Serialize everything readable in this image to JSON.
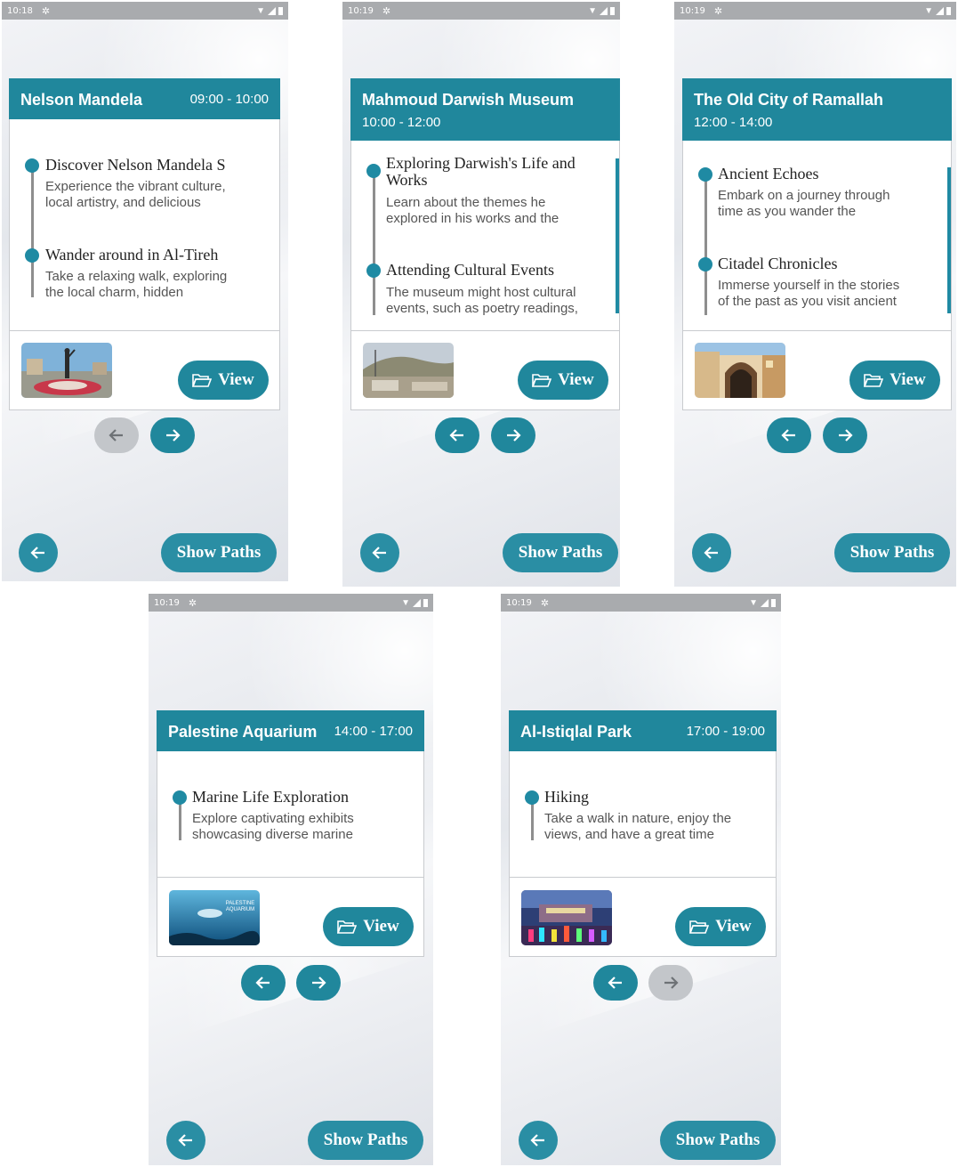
{
  "colors": {
    "accent": "#20879c",
    "disabled": "#c3c6ca",
    "status_bar": "#a9abae"
  },
  "view_label": "View",
  "show_paths_label": "Show Paths",
  "screens": [
    {
      "status_time": "10:18",
      "title": "Nelson Mandela",
      "time": "09:00 - 10:00",
      "prev_enabled": false,
      "next_enabled": true,
      "activities": [
        {
          "title": "Discover Nelson Mandela S",
          "desc1": "Experience the vibrant culture,",
          "desc2": "local artistry, and delicious"
        },
        {
          "title": "Wander around in Al-Tireh",
          "desc1": "Take a relaxing walk, exploring",
          "desc2": "the local charm, hidden"
        }
      ],
      "image_icon": "statue-plaza-photo"
    },
    {
      "status_time": "10:19",
      "title": "Mahmoud Darwish Museum",
      "time": "10:00 - 12:00",
      "prev_enabled": true,
      "next_enabled": true,
      "activities": [
        {
          "title": "Exploring Darwish's Life and",
          "title2": "Works",
          "desc1": "Learn about the themes he",
          "desc2": "explored in his works and the"
        },
        {
          "title": "Attending Cultural Events",
          "desc1": "The museum might host cultural",
          "desc2": "events, such as poetry readings,"
        }
      ],
      "image_icon": "museum-hill-photo"
    },
    {
      "status_time": "10:19",
      "title": "The Old City of Ramallah",
      "time": "12:00 - 14:00",
      "prev_enabled": true,
      "next_enabled": true,
      "activities": [
        {
          "title": "Ancient Echoes",
          "desc1": "Embark on a journey through",
          "desc2": "time as you wander the"
        },
        {
          "title": "Citadel Chronicles",
          "desc1": "Immerse yourself in the stories",
          "desc2": "of the past as you visit ancient"
        }
      ],
      "image_icon": "old-city-arch-photo"
    },
    {
      "status_time": "10:19",
      "title": "Palestine Aquarium",
      "time": "14:00 - 17:00",
      "prev_enabled": true,
      "next_enabled": true,
      "activities": [
        {
          "title": "Marine Life Exploration",
          "desc1": "Explore captivating exhibits",
          "desc2": "showcasing diverse marine"
        }
      ],
      "image_icon": "aquarium-photo",
      "image_text": "PALESTINE AQUARIUM"
    },
    {
      "status_time": "10:19",
      "title": "Al-Istiqlal Park",
      "time": "17:00 - 19:00",
      "prev_enabled": true,
      "next_enabled": false,
      "activities": [
        {
          "title": "Hiking",
          "desc1": "Take a walk in nature, enjoy the",
          "desc2": "views, and have a great time"
        }
      ],
      "image_icon": "park-fountain-photo"
    }
  ]
}
